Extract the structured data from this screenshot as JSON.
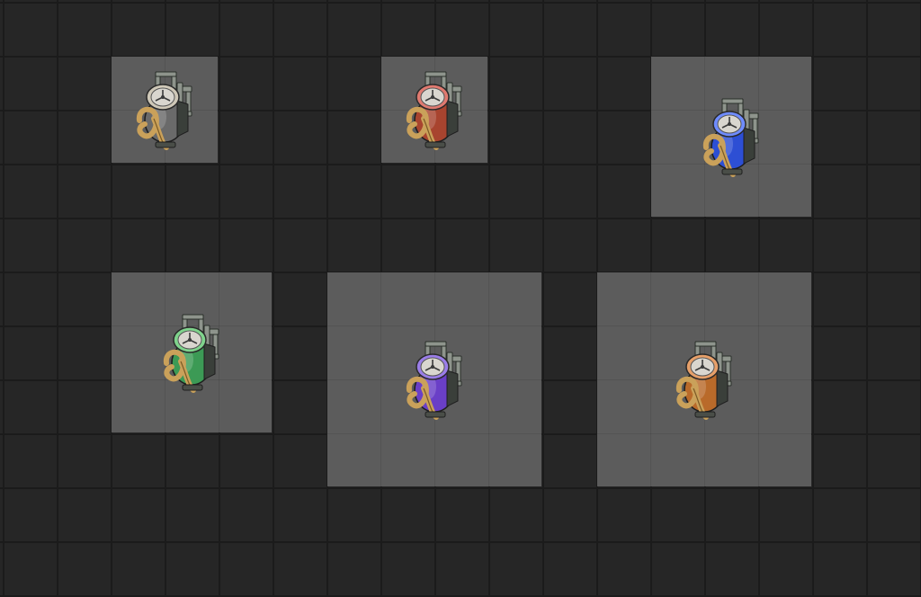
{
  "inventory": {
    "items": [
      {
        "icon": "pump-machine-icon",
        "color": "white",
        "accent": "#cfc8b8",
        "body": "#6a6a6a"
      },
      {
        "icon": "pump-machine-icon",
        "color": "red",
        "accent": "#e07a70",
        "body": "#a8442f"
      },
      {
        "icon": "pump-machine-icon",
        "color": "blue",
        "accent": "#6f8cff",
        "body": "#2d4fd4"
      },
      {
        "icon": "pump-machine-icon",
        "color": "green",
        "accent": "#7fd38c",
        "body": "#3c9a55"
      },
      {
        "icon": "pump-machine-icon",
        "color": "purple",
        "accent": "#9b7ee8",
        "body": "#6a3fc7"
      },
      {
        "icon": "pump-machine-icon",
        "color": "orange",
        "accent": "#e7a06a",
        "body": "#b96a2a"
      }
    ]
  },
  "colors": {
    "background": "#262626",
    "grid_line": "#1b1b1b",
    "slot": "#5c5c5c"
  }
}
